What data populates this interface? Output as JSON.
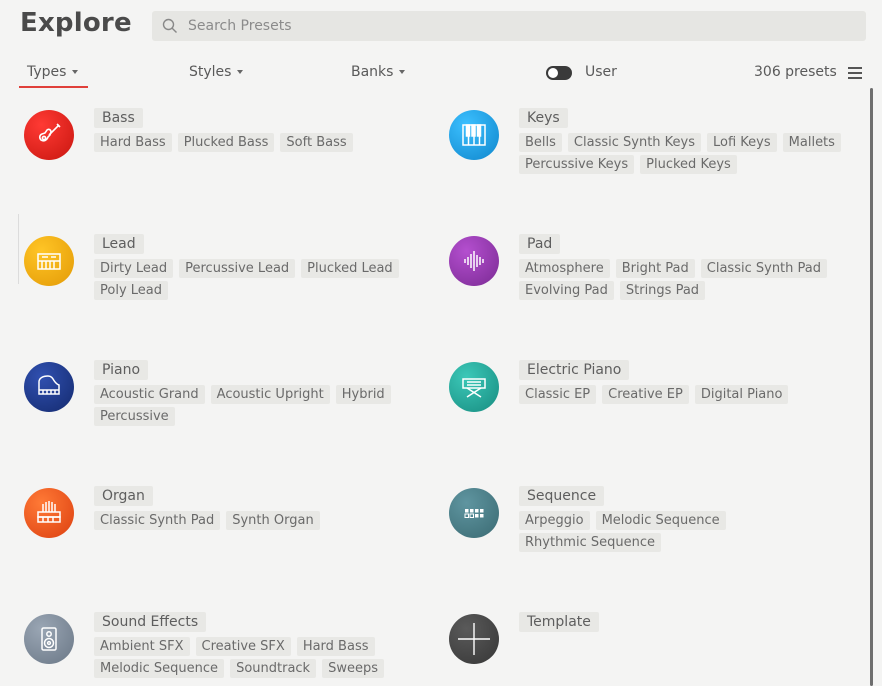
{
  "header": {
    "title": "Explore",
    "search_placeholder": "Search Presets"
  },
  "filters": {
    "types": "Types",
    "styles": "Styles",
    "banks": "Banks",
    "user_label": "User",
    "user_toggle_on": true,
    "preset_count": "306 presets"
  },
  "colors": {
    "accent": "#e0403a",
    "bass": "#d9211c",
    "keys": "#1a9be0",
    "lead": "#e9a80d",
    "pad": "#8f3aa8",
    "piano": "#1e3a8a",
    "electric_piano": "#23a79a",
    "organ": "#ea5a1c",
    "sequence": "#4a7e86",
    "sound_effects": "#7d8a9a",
    "template": "#4a4a4a"
  },
  "categories": {
    "bass": {
      "name": "Bass",
      "icon": "guitar-icon",
      "tags": [
        "Hard Bass",
        "Plucked Bass",
        "Soft Bass"
      ]
    },
    "keys": {
      "name": "Keys",
      "icon": "keyboard-icon",
      "tags": [
        "Bells",
        "Classic Synth Keys",
        "Lofi Keys",
        "Mallets",
        "Percussive Keys",
        "Plucked Keys"
      ]
    },
    "lead": {
      "name": "Lead",
      "icon": "synth-icon",
      "tags": [
        "Dirty Lead",
        "Percussive Lead",
        "Plucked Lead",
        "Poly Lead"
      ]
    },
    "pad": {
      "name": "Pad",
      "icon": "waveform-icon",
      "tags": [
        "Atmosphere",
        "Bright Pad",
        "Classic Synth Pad",
        "Evolving Pad",
        "Strings Pad"
      ]
    },
    "piano": {
      "name": "Piano",
      "icon": "grand-piano-icon",
      "tags": [
        "Acoustic Grand",
        "Acoustic Upright",
        "Hybrid",
        "Percussive"
      ]
    },
    "electric_piano": {
      "name": "Electric Piano",
      "icon": "electric-piano-icon",
      "tags": [
        "Classic EP",
        "Creative EP",
        "Digital Piano"
      ]
    },
    "organ": {
      "name": "Organ",
      "icon": "organ-icon",
      "tags": [
        "Classic Synth Pad",
        "Synth Organ"
      ]
    },
    "sequence": {
      "name": "Sequence",
      "icon": "sequencer-icon",
      "tags": [
        "Arpeggio",
        "Melodic Sequence",
        "Rhythmic Sequence"
      ]
    },
    "sound_effects": {
      "name": "Sound Effects",
      "icon": "speaker-icon",
      "tags": [
        "Ambient SFX",
        "Creative SFX",
        "Hard Bass",
        "Melodic Sequence",
        "Soundtrack",
        "Sweeps"
      ]
    },
    "template": {
      "name": "Template",
      "icon": "plus-icon",
      "tags": []
    }
  }
}
